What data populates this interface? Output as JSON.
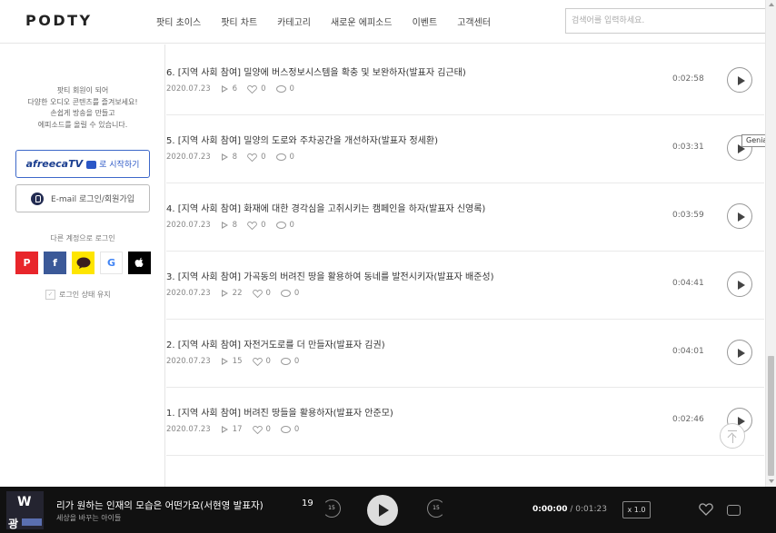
{
  "header": {
    "logo": "PODTY",
    "nav": [
      "팟티 초이스",
      "팟티 차트",
      "카테고리",
      "새로운 에피소드",
      "이벤트",
      "고객센터"
    ],
    "search_placeholder": "검색어를 입력하세요."
  },
  "sidebar": {
    "promo_lines": [
      "팟티 회원이 되어",
      "다양한 오디오 콘텐츠를 즐겨보세요!",
      "손쉽게 방송을 만들고",
      "에피소드를 올릴 수 있습니다."
    ],
    "afreeca_logo": "afreecaTV",
    "afreeca_label": "로 시작하기",
    "email_label": "E-mail 로그인/회원가입",
    "other_login": "다른 계정으로 로그인",
    "social": [
      "P",
      "f",
      "kakao",
      "G",
      "apple"
    ],
    "keep_login": "로그인 상태 유지"
  },
  "episodes": [
    {
      "title": "6. [지역 사회 참여] 밀양에 버스정보시스템을 확충 및 보완하자(발표자 김근태)",
      "date": "2020.07.23",
      "plays": "6",
      "likes": "0",
      "comments": "0",
      "duration": "0:02:58"
    },
    {
      "title": "5. [지역 사회 참여] 밀양의 도로와 주차공간을 개선하자(발표자 정세환)",
      "date": "2020.07.23",
      "plays": "8",
      "likes": "0",
      "comments": "0",
      "duration": "0:03:31"
    },
    {
      "title": "4. [지역 사회 참여] 화재에 대한 경각심을 고취시키는 캠페인을 하자(발표자 신영록)",
      "date": "2020.07.23",
      "plays": "8",
      "likes": "0",
      "comments": "0",
      "duration": "0:03:59"
    },
    {
      "title": "3. [지역 사회 참여] 가곡동의 버려진 땅을 활용하여 동네를 발전시키자(발표자 배준성)",
      "date": "2020.07.23",
      "plays": "22",
      "likes": "0",
      "comments": "0",
      "duration": "0:04:41"
    },
    {
      "title": "2. [지역 사회 참여] 자전거도로를 더 만들자(발표자 김권)",
      "date": "2020.07.23",
      "plays": "15",
      "likes": "0",
      "comments": "0",
      "duration": "0:04:01"
    },
    {
      "title": "1. [지역 사회 참여] 버려진 땅들을 활용하자(발표자 안준모)",
      "date": "2020.07.23",
      "plays": "17",
      "likes": "0",
      "comments": "0",
      "duration": "0:02:46"
    }
  ],
  "tooltip": "Genian 나",
  "player": {
    "cover_letter_top": "W",
    "cover_letter_bottom": "광",
    "title": "리가 원하는 인재의 모습은 어떤가요(서현영 발표자)",
    "subtitle": "세상을 바꾸는 아이들",
    "number": "19",
    "skip_back": "15",
    "skip_forward": "15",
    "current_time": "0:00:00",
    "separator": " / ",
    "total_time": "0:01:23",
    "speed": "x 1.0"
  },
  "colors": {
    "accent": "#2b57c6",
    "player_bg": "#111111",
    "kakao": "#fee500",
    "podty_red": "#e8262b"
  }
}
